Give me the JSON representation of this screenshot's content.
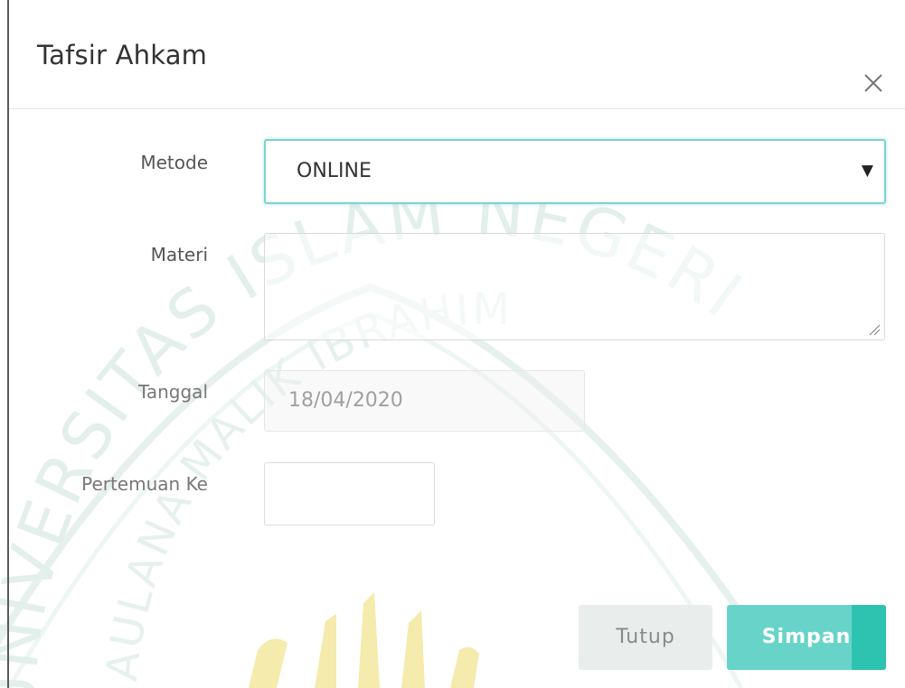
{
  "modal": {
    "title": "Tafsir Ahkam"
  },
  "form": {
    "metode_label": "Metode",
    "metode_value": "ONLINE",
    "materi_label": "Materi",
    "materi_value": "",
    "tanggal_label": "Tanggal",
    "tanggal_value": "18/04/2020",
    "pertemuan_label": "Pertemuan Ke",
    "pertemuan_value": ""
  },
  "buttons": {
    "close_label": "Tutup",
    "save_label": "Simpan"
  },
  "watermark": {
    "line1": "UNIVERSITAS ISLAM NEGERI",
    "line2": "MAULANA MALIK IBRAHIM"
  },
  "icons": {
    "close": "close-icon",
    "dropdown": "caret-down-icon",
    "resize": "resize-grip-icon"
  },
  "colors": {
    "accent": "#68d4c9",
    "accent_dark": "#2ec2b1",
    "focus_border": "#7dd3cf",
    "watermark_green": "#dceee8",
    "watermark_gold": "#f3e9a8"
  }
}
